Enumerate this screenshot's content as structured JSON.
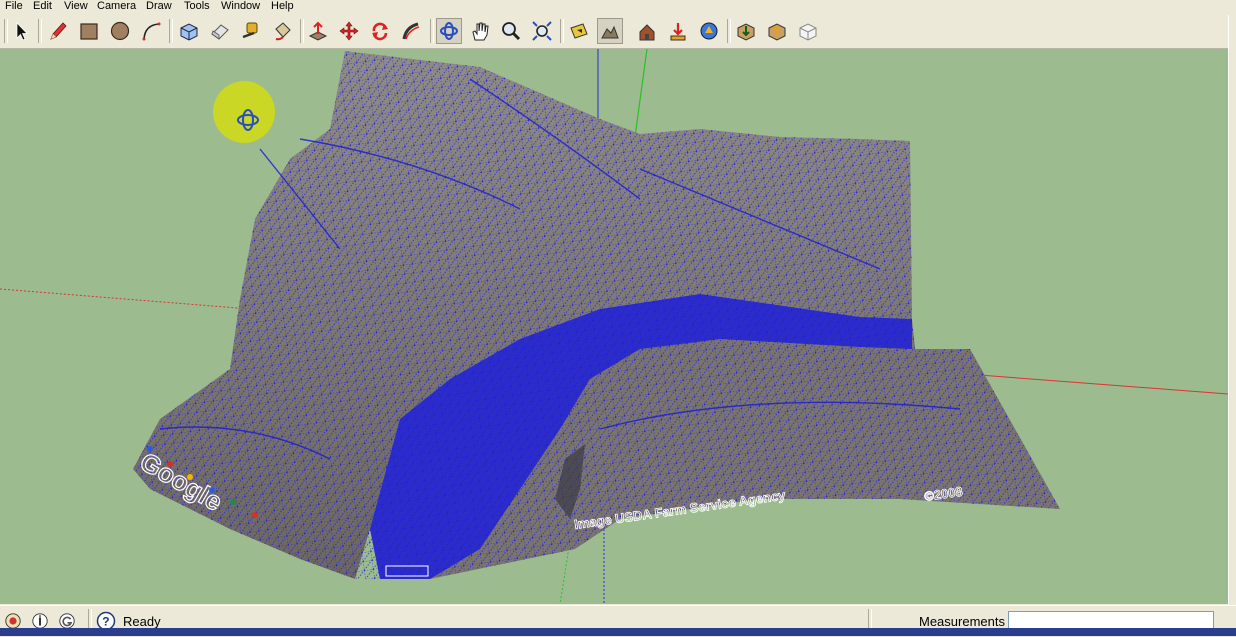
{
  "menu": {
    "items": [
      "File",
      "Edit",
      "View",
      "Camera",
      "Draw",
      "Tools",
      "Window",
      "Help"
    ]
  },
  "toolbar": {
    "groups": [
      [
        "select-icon"
      ],
      [
        "pencil-icon",
        "rectangle-icon",
        "circle-icon",
        "arc-icon"
      ],
      [
        "make-component-icon",
        "eraser-icon",
        "tape-measure-icon",
        "paint-bucket-icon"
      ],
      [
        "push-pull-icon",
        "move-icon",
        "rotate-icon",
        "follow-me-icon"
      ],
      [
        "orbit-icon",
        "pan-icon",
        "zoom-icon",
        "zoom-extents-icon"
      ],
      [
        "get-current-view-icon",
        "toggle-terrain-icon",
        "place-model-icon",
        "get-models-icon",
        "share-model-icon"
      ],
      [
        "get-models-3d-icon",
        "share-component-icon",
        "warehouse-icon"
      ]
    ],
    "active": [
      "orbit-icon",
      "toggle-terrain-icon"
    ]
  },
  "viewport": {
    "background_color": "#9cbb8f",
    "mesh_color": "#2020e0",
    "terrain_color": "#7a7670",
    "imagery_credit": "Image USDA Farm Service Agency",
    "copyright_text": "©2008",
    "google_logo": "Google",
    "tool_cursor": "orbit-cursor-icon"
  },
  "status": {
    "text": "Ready",
    "icons": [
      "geo-location-icon",
      "credits-icon",
      "google-signin-icon",
      "help-icon"
    ],
    "measurements_label": "Measurements",
    "measurements_value": ""
  }
}
